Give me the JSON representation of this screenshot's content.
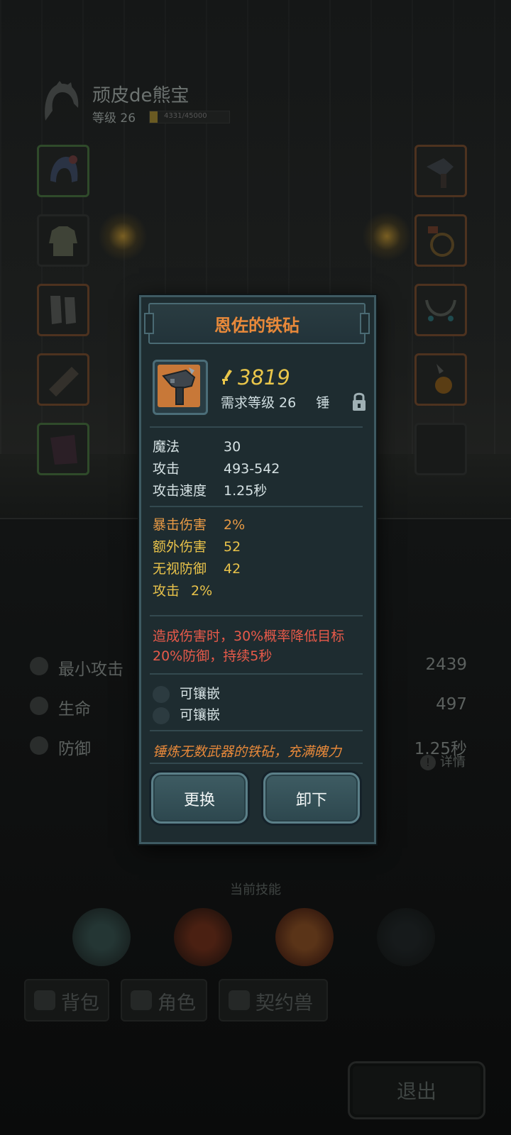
{
  "player": {
    "name": "顽皮de熊宝",
    "level_label": "等级 26",
    "xp_text": "4331/45000",
    "xp_fraction": 0.096
  },
  "equipment_slots": {
    "left": [
      "helmet-icon",
      "armor-icon",
      "boots-icon",
      "bracer-icon",
      "cape-icon"
    ],
    "right": [
      "hammer-icon",
      "ring-icon",
      "necklace-icon",
      "amulet-icon",
      "empty-slot"
    ]
  },
  "stats": [
    {
      "label": "最小攻击",
      "value": "2439",
      "icon": "sword-icon"
    },
    {
      "label": "生命",
      "value": "497",
      "icon": "heart-icon"
    },
    {
      "label": "防御",
      "value": "1.25秒",
      "icon": "shield-icon"
    }
  ],
  "details_label": "详情",
  "skills_label": "当前技能",
  "tabs": [
    {
      "label": "背包",
      "icon": "bag-icon"
    },
    {
      "label": "角色",
      "icon": "character-icon"
    },
    {
      "label": "契约兽",
      "icon": "paw-icon"
    }
  ],
  "exit_label": "退出",
  "dialog": {
    "title": "恩佐的铁砧",
    "power": "3819",
    "requirement": "需求等级 26",
    "type": "锤",
    "base_stats": [
      {
        "label": "魔法",
        "value": "30"
      },
      {
        "label": "攻击",
        "value": "493-542"
      },
      {
        "label": "攻击速度",
        "value": "1.25秒"
      }
    ],
    "bonus_stats": [
      {
        "label": "暴击伤害",
        "value": "2%"
      },
      {
        "label": "额外伤害",
        "value": "52"
      },
      {
        "label": "无视防御",
        "value": "42"
      },
      {
        "label": "攻击",
        "value": "2%"
      }
    ],
    "effect": "造成伤害时，30%概率降低目标20%防御，持续5秒",
    "sockets": [
      "可镶嵌",
      "可镶嵌"
    ],
    "flavor": "锤炼无数武器的铁砧，充满魄力",
    "buttons": {
      "replace": "更换",
      "unequip": "卸下"
    }
  },
  "colors": {
    "title": "#e8893a",
    "bonus_label": "#e89a45",
    "bonus_value": "#e8c24a",
    "effect": "#e85a4a",
    "power": "#e9c64a"
  }
}
